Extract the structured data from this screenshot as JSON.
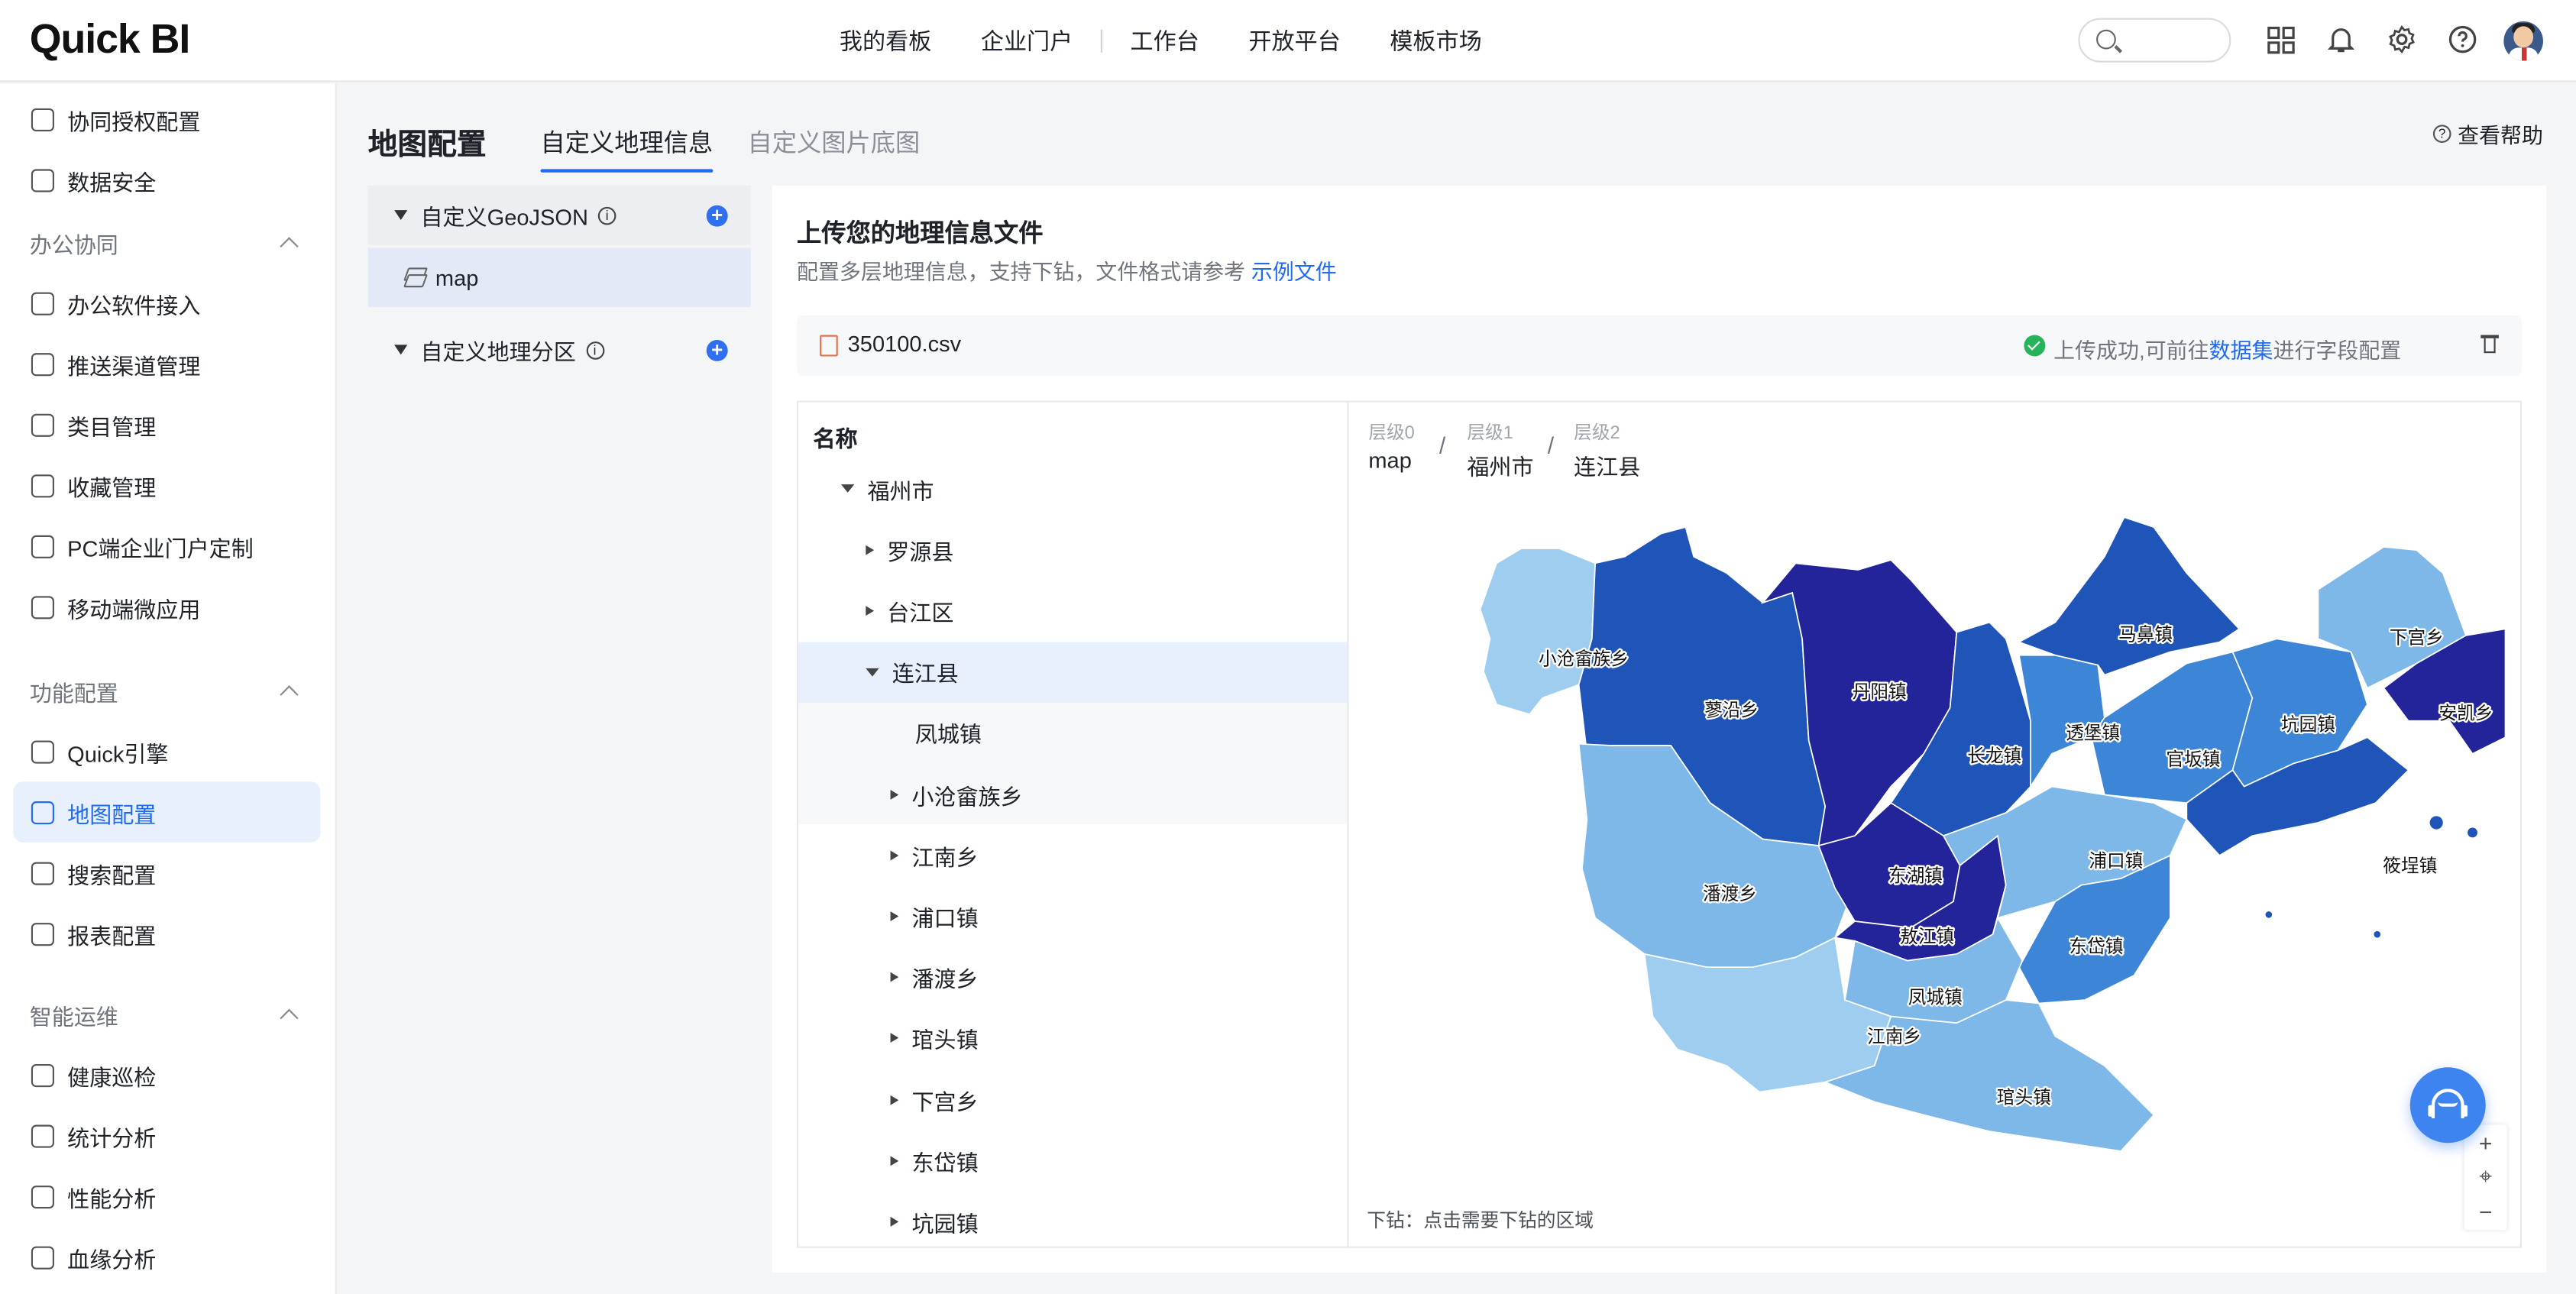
{
  "app": {
    "logo": "Quick BI"
  },
  "topnav": {
    "items": [
      "我的看板",
      "企业门户",
      "工作台",
      "开放平台",
      "模板市场"
    ]
  },
  "sidebar": {
    "items": [
      {
        "label": "协同授权配置",
        "icon": "shield-key-icon"
      },
      {
        "label": "数据安全",
        "icon": "shield-check-icon"
      },
      {
        "group": "办公协同"
      },
      {
        "label": "办公软件接入",
        "icon": "office-icon"
      },
      {
        "label": "推送渠道管理",
        "icon": "push-icon"
      },
      {
        "label": "类目管理",
        "icon": "category-icon"
      },
      {
        "label": "收藏管理",
        "icon": "star-icon"
      },
      {
        "label": "PC端企业门户定制",
        "icon": "monitor-icon"
      },
      {
        "label": "移动端微应用",
        "icon": "mobile-icon"
      },
      {
        "group": "功能配置"
      },
      {
        "label": "Quick引擎",
        "icon": "rocket-icon"
      },
      {
        "label": "地图配置",
        "icon": "map-pin-icon",
        "active": true
      },
      {
        "label": "搜索配置",
        "icon": "search-chat-icon"
      },
      {
        "label": "报表配置",
        "icon": "report-icon"
      },
      {
        "group": "智能运维"
      },
      {
        "label": "健康巡检",
        "icon": "health-icon"
      },
      {
        "label": "统计分析",
        "icon": "stats-icon"
      },
      {
        "label": "性能分析",
        "icon": "gauge-icon"
      },
      {
        "label": "血缘分析",
        "icon": "lineage-icon"
      }
    ]
  },
  "page": {
    "title": "地图配置",
    "tabs": [
      "自定义地理信息",
      "自定义图片底图"
    ],
    "active_tab": "自定义地理信息",
    "help": "查看帮助"
  },
  "left_panel": {
    "geojson_label": "自定义GeoJSON",
    "map_item": "map",
    "region_label": "自定义地理分区"
  },
  "upload": {
    "title": "上传您的地理信息文件",
    "desc": "配置多层地理信息，支持下钻，文件格式请参考",
    "desc_link": "示例文件",
    "file_name": "350100.csv",
    "status_pre": "上传成功,可前往",
    "status_link": "数据集",
    "status_post": "进行字段配置"
  },
  "tree": {
    "header": "名称",
    "rows": [
      {
        "label": "福州市",
        "level": 0,
        "expanded": true
      },
      {
        "label": "罗源县",
        "level": 1
      },
      {
        "label": "台江区",
        "level": 1
      },
      {
        "label": "连江县",
        "level": 1,
        "expanded": true,
        "selected": true
      },
      {
        "label": "凤城镇",
        "level": 2,
        "leaf": true
      },
      {
        "label": "小沧畲族乡",
        "level": 2
      },
      {
        "label": "江南乡",
        "level": 2
      },
      {
        "label": "浦口镇",
        "level": 2
      },
      {
        "label": "潘渡乡",
        "level": 2
      },
      {
        "label": "琯头镇",
        "level": 2
      },
      {
        "label": "下宫乡",
        "level": 2
      },
      {
        "label": "东岱镇",
        "level": 2
      },
      {
        "label": "坑园镇",
        "level": 2
      }
    ]
  },
  "map": {
    "breadcrumb": [
      {
        "level": "层级0",
        "value": "map"
      },
      {
        "level": "层级1",
        "value": "福州市"
      },
      {
        "level": "层级2",
        "value": "连江县"
      }
    ],
    "drill_tip": "下钻：点击需要下钻的区域",
    "regions": [
      "小沧畲族乡",
      "蓼沿乡",
      "丹阳镇",
      "长龙镇",
      "透堡镇",
      "马鼻镇",
      "官坂镇",
      "坑园镇",
      "下宫乡",
      "安凯乡",
      "潘渡乡",
      "东湖镇",
      "敖江镇",
      "浦口镇",
      "东岱镇",
      "凤城镇",
      "江南乡",
      "琯头镇",
      "筱埕镇"
    ],
    "zoom": {
      "in": "+",
      "reset": "⌖",
      "out": "−"
    },
    "colors": {
      "darkest": "#24249a",
      "dark": "#1f55b8",
      "mid": "#3d85d6",
      "light": "#7eb8e8",
      "lightest": "#9fcdef"
    }
  }
}
